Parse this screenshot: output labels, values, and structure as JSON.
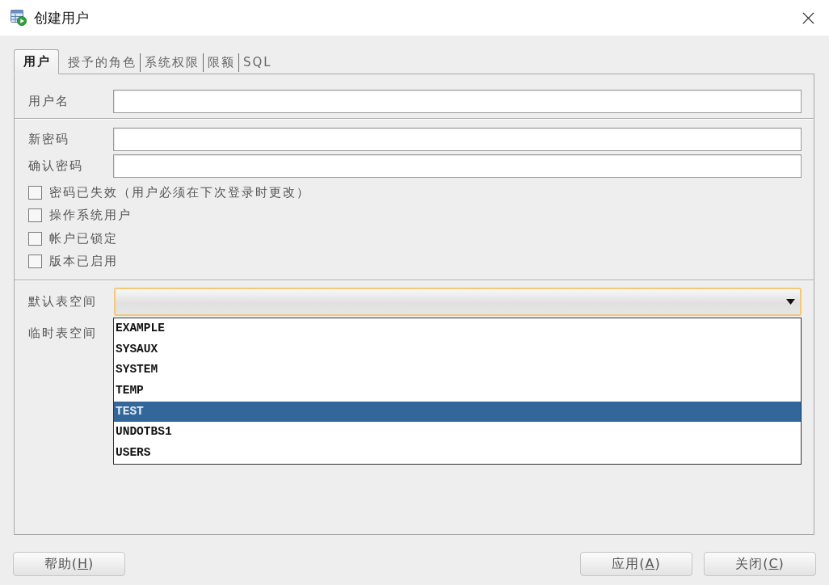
{
  "window": {
    "title": "创建用户"
  },
  "tabs": [
    {
      "label": "用户",
      "selected": true
    },
    {
      "label": "授予的角色",
      "selected": false
    },
    {
      "label": "系统权限",
      "selected": false
    },
    {
      "label": "限额",
      "selected": false
    },
    {
      "label": "SQL",
      "selected": false
    }
  ],
  "username": {
    "label": "用户名"
  },
  "password_fields": [
    {
      "label": "新密码"
    },
    {
      "label": "确认密码"
    }
  ],
  "checkboxes": [
    {
      "label": "密码已失效（用户必须在下次登录时更改）",
      "checked": false
    },
    {
      "label": "操作系统用户",
      "checked": false
    },
    {
      "label": "帐户已锁定",
      "checked": false
    },
    {
      "label": "版本已启用",
      "checked": false
    }
  ],
  "default_tablespace": {
    "label": "默认表空间",
    "focused": true,
    "expanded": true,
    "options": [
      {
        "label": "EXAMPLE",
        "selected": false
      },
      {
        "label": "SYSAUX",
        "selected": false
      },
      {
        "label": "SYSTEM",
        "selected": false
      },
      {
        "label": "TEMP",
        "selected": false
      },
      {
        "label": "TEST",
        "selected": true
      },
      {
        "label": "UNDOTBS1",
        "selected": false
      },
      {
        "label": "USERS",
        "selected": false
      }
    ]
  },
  "temporary_tablespace": {
    "label": "临时表空间"
  },
  "footer": {
    "left_buttons": [
      {
        "text_before": "帮助(",
        "mnemonic": "H",
        "text_after": ")"
      }
    ],
    "right_buttons": [
      {
        "text_before": "应用(",
        "mnemonic": "A",
        "text_after": ")"
      },
      {
        "text_before": "关闭(",
        "mnemonic": "C",
        "text_after": ")"
      }
    ]
  }
}
